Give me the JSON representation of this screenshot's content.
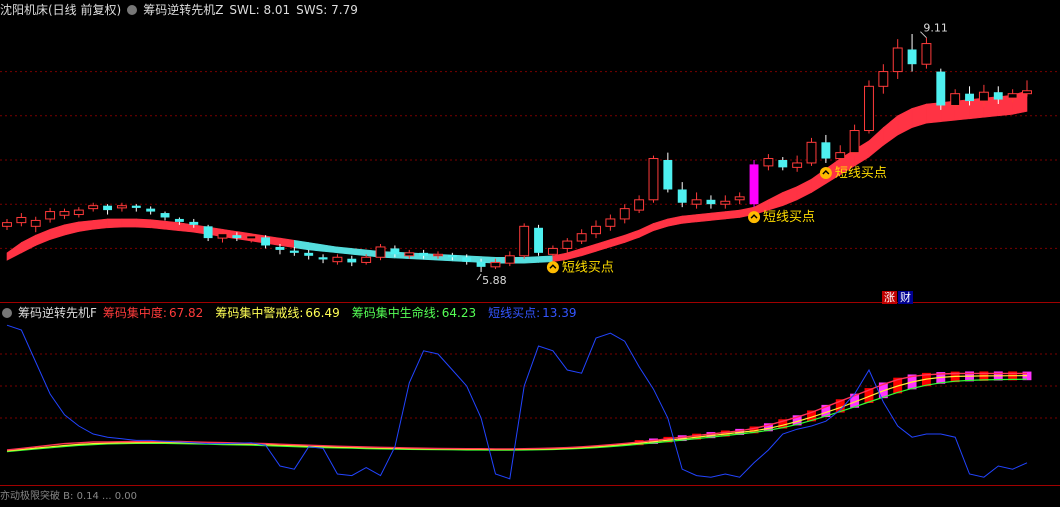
{
  "header": {
    "stock": "沈阳机床(日线 前复权)",
    "indicator": "筹码逆转先机Z",
    "swl": "SWL: 8.01",
    "sws": "SWS: 7.79"
  },
  "sub_header": {
    "name": "筹码逆转先机F",
    "items": [
      {
        "label": "筹码集中度:",
        "value": "67.82",
        "color": "#ff3b3b"
      },
      {
        "label": "筹码集中警戒线:",
        "value": "66.49",
        "color": "#ffff55"
      },
      {
        "label": "筹码集中生命线:",
        "value": "64.23",
        "color": "#55ff55"
      },
      {
        "label": "短线买点:",
        "value": "13.39",
        "color": "#3355ff"
      }
    ]
  },
  "bottom_header": {
    "text": "亦动极限突破 B: 0.14 ... 0.00"
  },
  "tags": {
    "zhang": "涨",
    "cai": "财"
  },
  "colors": {
    "up": "#ff3b3b",
    "down": "#4ef0f0",
    "ribbon_up": "#ff3344",
    "ribbon_down": "#55dddd",
    "buy_signal": "#ff00ff",
    "grid": "#7a0000",
    "conc": "#ff0000",
    "warn": "#ffee33",
    "life": "#33ff33",
    "short": "#2244ff"
  },
  "chart_data": [
    {
      "type": "candlestick",
      "ylim": [
        5.5,
        9.3
      ],
      "annotations": [
        {
          "text": "9.11",
          "index": 64
        },
        {
          "text": "5.88",
          "index": 33
        },
        {
          "text": "短线买点",
          "index": 38
        },
        {
          "text": "短线买点",
          "index": 52
        },
        {
          "text": "短线买点",
          "index": 57
        }
      ],
      "candles": [
        [
          6.5,
          6.55,
          6.45,
          6.6
        ],
        [
          6.55,
          6.62,
          6.5,
          6.68
        ],
        [
          6.5,
          6.58,
          6.42,
          6.63
        ],
        [
          6.6,
          6.7,
          6.55,
          6.75
        ],
        [
          6.65,
          6.7,
          6.6,
          6.74
        ],
        [
          6.66,
          6.72,
          6.62,
          6.76
        ],
        [
          6.74,
          6.78,
          6.7,
          6.82
        ],
        [
          6.78,
          6.72,
          6.66,
          6.8
        ],
        [
          6.75,
          6.78,
          6.7,
          6.82
        ],
        [
          6.78,
          6.75,
          6.7,
          6.8
        ],
        [
          6.74,
          6.7,
          6.66,
          6.77
        ],
        [
          6.68,
          6.62,
          6.58,
          6.7
        ],
        [
          6.6,
          6.56,
          6.52,
          6.62
        ],
        [
          6.56,
          6.52,
          6.48,
          6.6
        ],
        [
          6.5,
          6.34,
          6.3,
          6.52
        ],
        [
          6.34,
          6.4,
          6.28,
          6.44
        ],
        [
          6.38,
          6.34,
          6.3,
          6.42
        ],
        [
          6.33,
          6.37,
          6.28,
          6.4
        ],
        [
          6.35,
          6.24,
          6.2,
          6.38
        ],
        [
          6.22,
          6.18,
          6.12,
          6.26
        ],
        [
          6.17,
          6.14,
          6.1,
          6.22
        ],
        [
          6.14,
          6.1,
          6.05,
          6.18
        ],
        [
          6.08,
          6.05,
          6.0,
          6.12
        ],
        [
          6.02,
          6.08,
          5.98,
          6.12
        ],
        [
          6.06,
          6.01,
          5.96,
          6.1
        ],
        [
          6.01,
          6.08,
          5.98,
          6.12
        ],
        [
          6.08,
          6.22,
          6.04,
          6.26
        ],
        [
          6.2,
          6.12,
          6.08,
          6.24
        ],
        [
          6.1,
          6.14,
          6.06,
          6.18
        ],
        [
          6.14,
          6.1,
          6.06,
          6.18
        ],
        [
          6.1,
          6.12,
          6.06,
          6.16
        ],
        [
          6.11,
          6.08,
          6.04,
          6.14
        ],
        [
          6.08,
          6.02,
          5.98,
          6.12
        ],
        [
          6.02,
          5.95,
          5.88,
          6.06
        ],
        [
          5.95,
          6.01,
          5.92,
          6.06
        ],
        [
          6.0,
          6.1,
          5.96,
          6.16
        ],
        [
          6.1,
          6.5,
          6.06,
          6.54
        ],
        [
          6.48,
          6.14,
          6.1,
          6.52
        ],
        [
          6.12,
          6.2,
          6.08,
          6.24
        ],
        [
          6.2,
          6.3,
          6.14,
          6.34
        ],
        [
          6.3,
          6.4,
          6.26,
          6.46
        ],
        [
          6.4,
          6.5,
          6.34,
          6.58
        ],
        [
          6.5,
          6.6,
          6.44,
          6.66
        ],
        [
          6.6,
          6.74,
          6.54,
          6.8
        ],
        [
          6.72,
          6.86,
          6.68,
          6.92
        ],
        [
          6.86,
          7.42,
          6.82,
          7.46
        ],
        [
          7.4,
          7.0,
          6.96,
          7.5
        ],
        [
          7.0,
          6.82,
          6.76,
          7.1
        ],
        [
          6.8,
          6.86,
          6.74,
          6.96
        ],
        [
          6.86,
          6.8,
          6.74,
          6.92
        ],
        [
          6.8,
          6.84,
          6.74,
          6.92
        ],
        [
          6.86,
          6.9,
          6.8,
          6.96
        ],
        [
          6.8,
          7.34,
          6.76,
          7.4
        ],
        [
          7.32,
          7.42,
          7.26,
          7.48
        ],
        [
          7.4,
          7.3,
          7.26,
          7.44
        ],
        [
          7.3,
          7.36,
          7.24,
          7.46
        ],
        [
          7.36,
          7.64,
          7.32,
          7.7
        ],
        [
          7.64,
          7.42,
          7.36,
          7.74
        ],
        [
          7.42,
          7.5,
          7.36,
          7.6
        ],
        [
          7.5,
          7.8,
          7.46,
          7.88
        ],
        [
          7.8,
          8.4,
          7.76,
          8.48
        ],
        [
          8.4,
          8.6,
          8.3,
          8.7
        ],
        [
          8.6,
          8.92,
          8.5,
          9.04
        ],
        [
          8.9,
          8.7,
          8.6,
          9.11
        ],
        [
          8.7,
          8.98,
          8.64,
          9.06
        ],
        [
          8.6,
          8.14,
          8.08,
          8.64
        ],
        [
          8.14,
          8.3,
          8.08,
          8.36
        ],
        [
          8.3,
          8.2,
          8.14,
          8.4
        ],
        [
          8.2,
          8.32,
          8.12,
          8.42
        ],
        [
          8.32,
          8.22,
          8.16,
          8.4
        ],
        [
          8.24,
          8.3,
          8.18,
          8.36
        ],
        [
          8.3,
          8.34,
          8.26,
          8.48
        ]
      ],
      "ribbon_upper": [
        6.14,
        6.28,
        6.38,
        6.46,
        6.52,
        6.56,
        6.58,
        6.6,
        6.6,
        6.6,
        6.59,
        6.57,
        6.55,
        6.52,
        6.49,
        6.46,
        6.43,
        6.4,
        6.37,
        6.34,
        6.31,
        6.28,
        6.25,
        6.22,
        6.2,
        6.18,
        6.16,
        6.15,
        6.14,
        6.13,
        6.12,
        6.11,
        6.1,
        6.09,
        6.08,
        6.08,
        6.08,
        6.09,
        6.1,
        6.14,
        6.2,
        6.26,
        6.32,
        6.38,
        6.45,
        6.54,
        6.6,
        6.64,
        6.66,
        6.68,
        6.7,
        6.72,
        6.76,
        6.86,
        6.96,
        7.04,
        7.14,
        7.28,
        7.42,
        7.54,
        7.66,
        7.84,
        8.0,
        8.1,
        8.16,
        8.18,
        8.2,
        8.22,
        8.24,
        8.26,
        8.28,
        8.34
      ],
      "ribbon_lower": [
        6.04,
        6.14,
        6.24,
        6.32,
        6.38,
        6.43,
        6.46,
        6.48,
        6.49,
        6.49,
        6.48,
        6.46,
        6.44,
        6.42,
        6.39,
        6.36,
        6.33,
        6.3,
        6.27,
        6.24,
        6.21,
        6.18,
        6.16,
        6.14,
        6.12,
        6.1,
        6.08,
        6.07,
        6.06,
        6.05,
        6.04,
        6.03,
        6.02,
        6.01,
        6.0,
        6.0,
        6.0,
        6.01,
        6.02,
        6.05,
        6.1,
        6.16,
        6.22,
        6.28,
        6.35,
        6.44,
        6.5,
        6.54,
        6.56,
        6.58,
        6.6,
        6.62,
        6.66,
        6.72,
        6.78,
        6.86,
        6.96,
        7.08,
        7.2,
        7.32,
        7.44,
        7.6,
        7.74,
        7.84,
        7.9,
        7.92,
        7.94,
        7.96,
        7.98,
        8.0,
        8.02,
        8.06
      ]
    },
    {
      "type": "line",
      "ylim": [
        0,
        100
      ],
      "series": [
        {
          "name": "筹码集中度",
          "values": [
            20,
            21,
            22,
            23,
            24,
            24.5,
            25,
            25,
            25.2,
            25.3,
            25.3,
            25.3,
            25.3,
            25,
            24.8,
            24.6,
            24.4,
            24.2,
            24,
            23.6,
            23.3,
            23,
            22.7,
            22.4,
            22.1,
            21.9,
            21.7,
            21.5,
            21.3,
            21.1,
            21,
            20.9,
            20.8,
            20.8,
            20.7,
            20.7,
            20.8,
            21,
            21.2,
            21.5,
            22,
            22.6,
            23.3,
            24.1,
            25,
            26,
            27,
            28,
            29,
            30,
            31,
            32,
            33.5,
            35.5,
            38,
            40.5,
            43.5,
            47,
            50.5,
            54,
            57.5,
            61,
            64,
            66,
            67,
            67.5,
            67.8,
            67.9,
            67.9,
            67.9,
            67.9,
            67.82
          ]
        },
        {
          "name": "筹码集中警戒线",
          "values": [
            19.5,
            20.3,
            21.2,
            22,
            22.8,
            23.5,
            24,
            24.3,
            24.5,
            24.6,
            24.7,
            24.7,
            24.6,
            24.4,
            24.2,
            24,
            23.8,
            23.6,
            23.3,
            23,
            22.7,
            22.4,
            22.1,
            21.8,
            21.6,
            21.4,
            21.2,
            21,
            20.8,
            20.7,
            20.6,
            20.5,
            20.4,
            20.4,
            20.3,
            20.3,
            20.4,
            20.5,
            20.7,
            21,
            21.5,
            22,
            22.7,
            23.5,
            24.3,
            25.2,
            26.1,
            27,
            28,
            29,
            30,
            31,
            32,
            33.5,
            35.5,
            37.8,
            40.5,
            43.5,
            46.5,
            50,
            53.5,
            57,
            60,
            62.5,
            64.3,
            65.4,
            66,
            66.2,
            66.3,
            66.4,
            66.45,
            66.49
          ]
        },
        {
          "name": "筹码集中生命线",
          "values": [
            19,
            19.8,
            20.6,
            21.4,
            22.2,
            22.9,
            23.4,
            23.8,
            24,
            24.1,
            24.1,
            24.1,
            24,
            23.8,
            23.6,
            23.4,
            23.2,
            23,
            22.7,
            22.4,
            22.1,
            21.8,
            21.5,
            21.3,
            21.1,
            20.9,
            20.7,
            20.5,
            20.4,
            20.3,
            20.2,
            20.1,
            20,
            20,
            19.9,
            19.9,
            20,
            20.1,
            20.3,
            20.6,
            21,
            21.5,
            22.1,
            22.8,
            23.6,
            24.4,
            25.3,
            26.2,
            27.1,
            28,
            29,
            30,
            31,
            32.3,
            34,
            36,
            38.5,
            41.2,
            44,
            47,
            50,
            53,
            56,
            58.5,
            60.5,
            62,
            63,
            63.5,
            63.8,
            64,
            64.1,
            64.23
          ]
        },
        {
          "name": "短线买点",
          "values": [
            98,
            95,
            75,
            55,
            42,
            35,
            30,
            28,
            27,
            26,
            26,
            25.5,
            25,
            24.5,
            24,
            24,
            24.2,
            24.5,
            23,
            10,
            8,
            22,
            21,
            5,
            4,
            9,
            4,
            22,
            62,
            82,
            80,
            70,
            60,
            40,
            5,
            2,
            60,
            85,
            82,
            70,
            68,
            90,
            93,
            88,
            72,
            58,
            40,
            8,
            4,
            3,
            5,
            3,
            12,
            20,
            30,
            33,
            35,
            38,
            45,
            55,
            70,
            50,
            35,
            28,
            30,
            30,
            28,
            5,
            3,
            10,
            8,
            12
          ]
        }
      ]
    }
  ]
}
